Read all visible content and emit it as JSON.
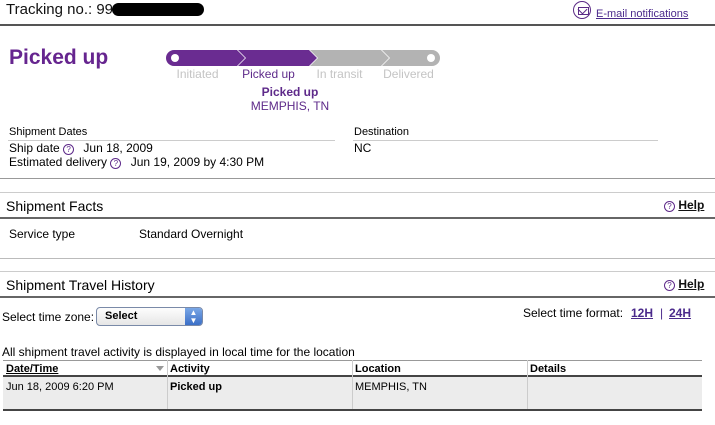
{
  "header": {
    "tracking_label": "Tracking no.: 99",
    "email_link": "E-mail notifications"
  },
  "status": {
    "title": "Picked up",
    "steps": [
      {
        "label": "Initiated",
        "active": false
      },
      {
        "label": "Picked up",
        "active": true
      },
      {
        "label": "In transit",
        "active": false
      },
      {
        "label": "Delivered",
        "active": false
      }
    ],
    "current_status": "Picked up",
    "current_location": "MEMPHIS, TN",
    "colors": {
      "active": "#6a2c91",
      "inactive": "#b3b3b3"
    }
  },
  "shipment_dates": {
    "heading": "Shipment Dates",
    "ship_date_label": "Ship date",
    "ship_date_value": "Jun 18, 2009",
    "estimated_label": "Estimated delivery",
    "estimated_value": "Jun 19, 2009 by 4:30 PM"
  },
  "destination": {
    "heading": "Destination",
    "value": "NC"
  },
  "shipment_facts": {
    "title": "Shipment Facts",
    "help": "Help",
    "service_type_label": "Service type",
    "service_type_value": "Standard Overnight"
  },
  "travel_history": {
    "title": "Shipment Travel History",
    "help": "Help",
    "timezone_label": "Select time zone:",
    "timezone_selected": "Select",
    "time_format_label": "Select time format:",
    "format_12h": "12H",
    "format_separator": "|",
    "format_24h": "24H",
    "note": "All shipment travel activity is displayed in local time for the location",
    "columns": [
      "Date/Time",
      "Activity",
      "Location",
      "Details"
    ],
    "rows": [
      {
        "datetime": "Jun 18, 2009 6:20 PM",
        "activity": "Picked up",
        "location": "MEMPHIS, TN",
        "details": ""
      }
    ]
  }
}
